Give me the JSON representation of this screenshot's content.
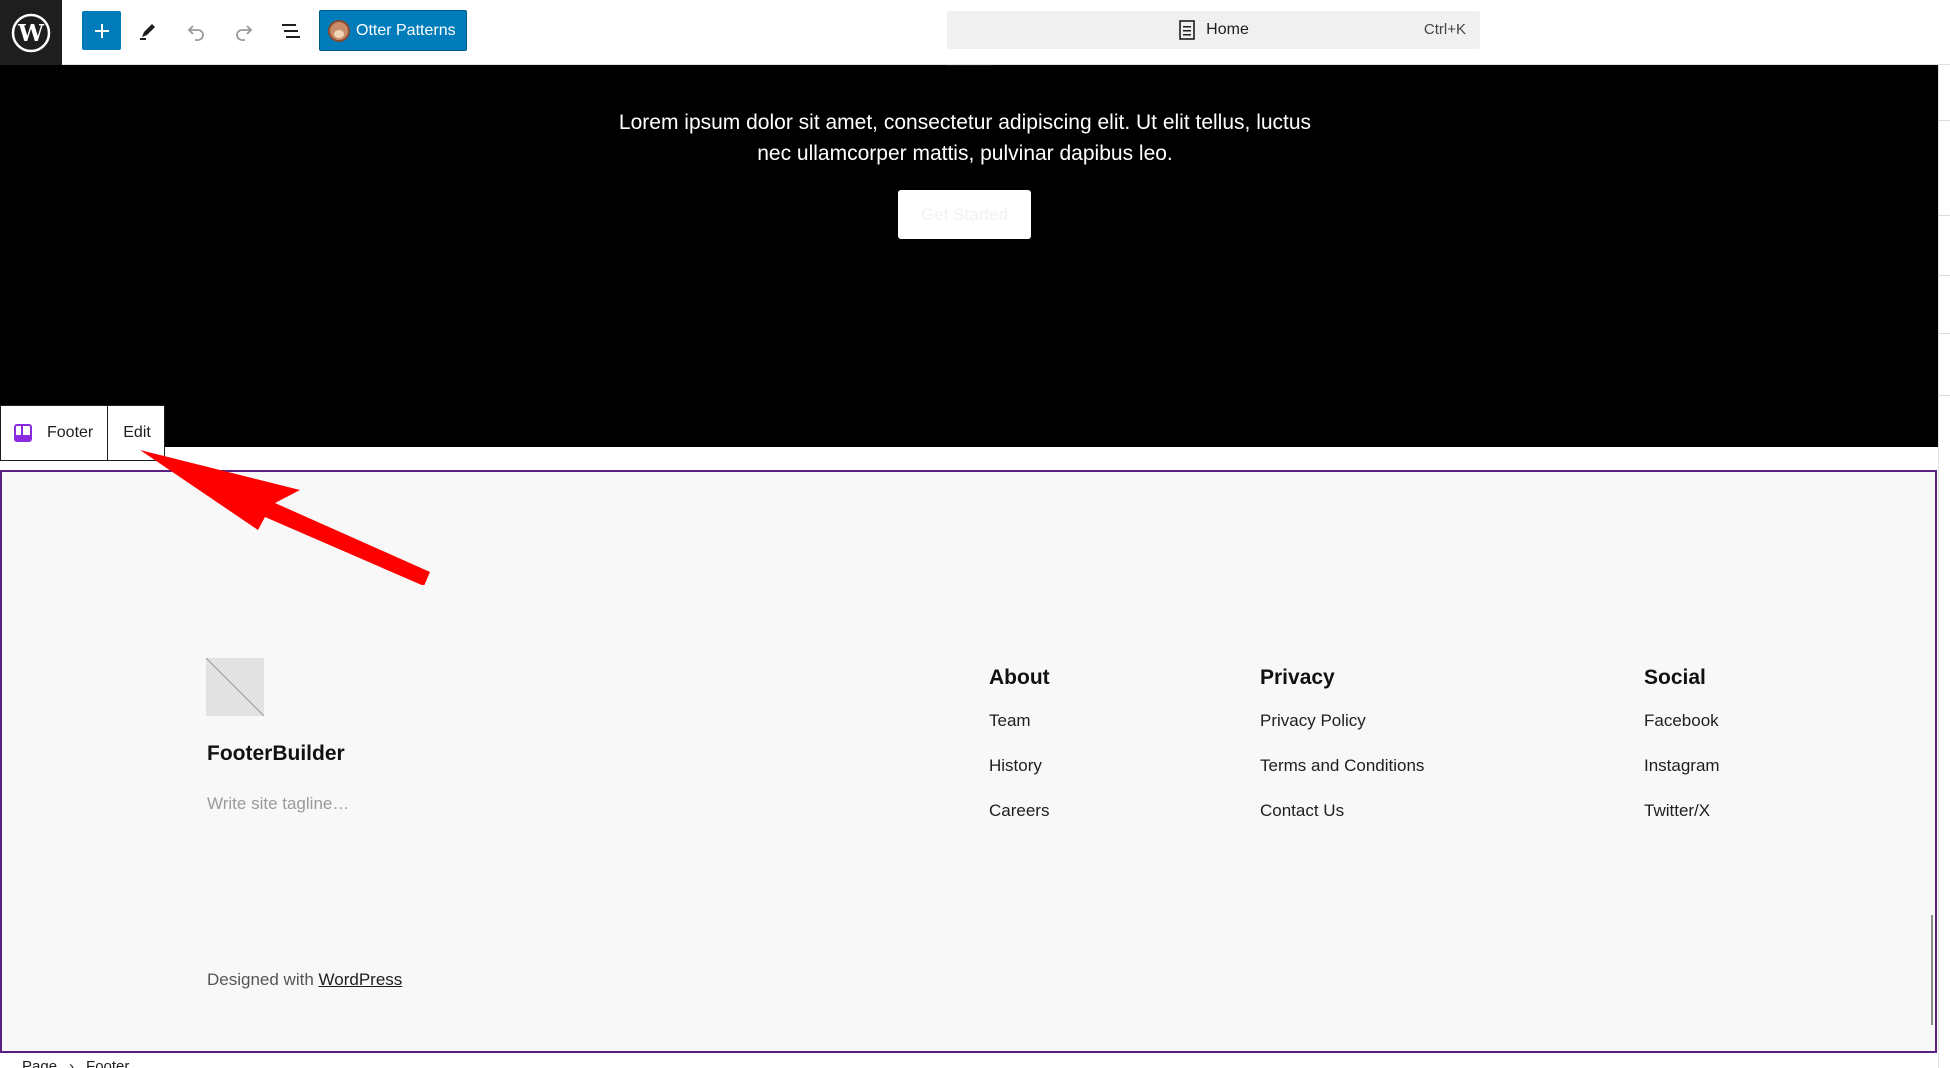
{
  "toolbar": {
    "add_label": "+",
    "otter_label": "Otter Patterns"
  },
  "command_bar": {
    "title": "Home",
    "shortcut": "Ctrl+K"
  },
  "hero": {
    "paragraph_line1": "Lorem ipsum dolor sit amet, consectetur adipiscing elit. Ut elit tellus, luctus",
    "paragraph_line2": "nec ullamcorper mattis, pulvinar dapibus leo.",
    "button_label": "Get Started",
    "background_color": "#000000"
  },
  "block_toolbar": {
    "block_name": "Footer",
    "edit_label": "Edit"
  },
  "footer": {
    "site_title": "FooterBuilder",
    "tagline_placeholder": "Write site tagline…",
    "columns": [
      {
        "heading": "About",
        "links": [
          "Team",
          "History",
          "Careers"
        ]
      },
      {
        "heading": "Privacy",
        "links": [
          "Privacy Policy",
          "Terms and Conditions",
          "Contact Us"
        ]
      },
      {
        "heading": "Social",
        "links": [
          "Facebook",
          "Instagram",
          "Twitter/X"
        ]
      }
    ],
    "credits_prefix": "Designed with",
    "credits_link": "WordPress",
    "border_color": "#5b1f82"
  },
  "breadcrumb": [
    "Page",
    "Footer"
  ],
  "icons": {
    "logo": "wordpress-logo-icon",
    "edit": "pencil-icon",
    "undo": "undo-icon",
    "redo": "redo-icon",
    "list_view": "list-view-icon",
    "document": "document-icon",
    "footer_block": "template-part-icon",
    "annotation": "red-arrow-annotation"
  },
  "accent_color": "#007cba"
}
